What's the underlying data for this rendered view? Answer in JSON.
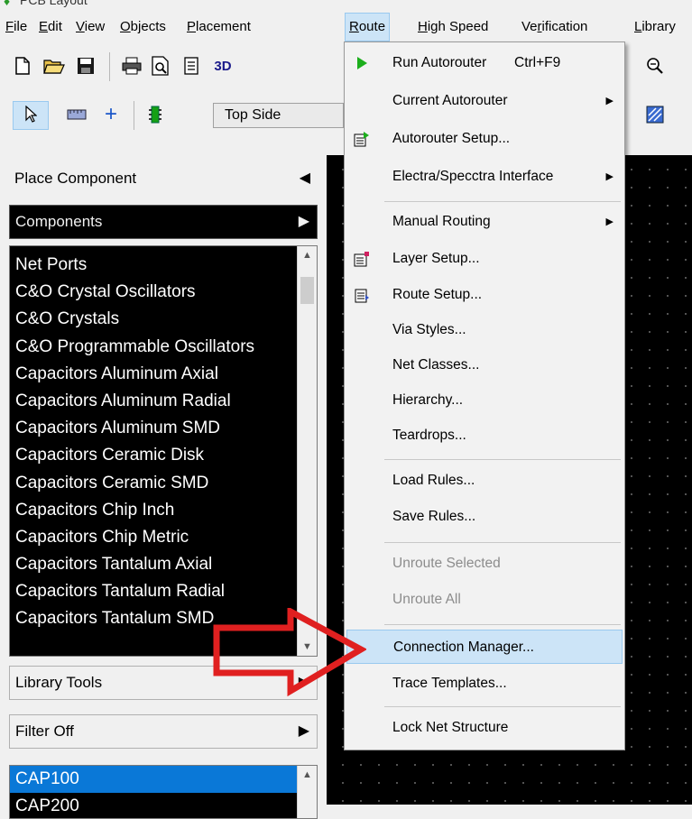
{
  "window": {
    "title": "PCB Layout"
  },
  "menubar": {
    "items": [
      {
        "label": "File",
        "underline": "F"
      },
      {
        "label": "Edit",
        "underline": "E"
      },
      {
        "label": "View",
        "underline": "V"
      },
      {
        "label": "Objects",
        "underline": "O"
      },
      {
        "label": "Placement",
        "underline": "P"
      },
      {
        "label": "Route",
        "underline": "R"
      },
      {
        "label": "High Speed",
        "underline": "H"
      },
      {
        "label": "Verification",
        "underline": "r"
      },
      {
        "label": "Library",
        "underline": "L"
      }
    ]
  },
  "toolbar1": {
    "threed_label": "3D"
  },
  "toolbar2": {
    "layer_select": "Top Side"
  },
  "left_panel": {
    "place_component": "Place Component",
    "components": "Components",
    "component_list": [
      "Net Ports",
      "C&O Crystal Oscillators",
      "C&O Crystals",
      "C&O Programmable Oscillators",
      "Capacitors Aluminum Axial",
      "Capacitors Aluminum Radial",
      "Capacitors Aluminum SMD",
      "Capacitors Ceramic Disk",
      "Capacitors Ceramic SMD",
      "Capacitors Chip Inch",
      "Capacitors Chip Metric",
      "Capacitors Tantalum Axial",
      "Capacitors Tantalum Radial",
      "Capacitors Tantalum SMD"
    ],
    "library_tools": "Library Tools",
    "filter": "Filter Off",
    "parts_list": [
      "CAP100",
      "CAP200"
    ],
    "selected_part": "CAP100"
  },
  "route_menu": {
    "items": [
      {
        "label": "Run Autorouter",
        "shortcut": "Ctrl+F9",
        "icon": "play-icon",
        "submenu": false,
        "disabled": false
      },
      {
        "label": "Current Autorouter",
        "shortcut": "",
        "icon": "",
        "submenu": true,
        "disabled": false
      },
      {
        "label": "Autorouter Setup...",
        "shortcut": "",
        "icon": "autorouter-setup-icon",
        "submenu": false,
        "disabled": false
      },
      {
        "label": "Electra/Specctra Interface",
        "shortcut": "",
        "icon": "",
        "submenu": true,
        "disabled": false
      },
      {
        "label": "Manual Routing",
        "shortcut": "",
        "icon": "",
        "submenu": true,
        "disabled": false
      },
      {
        "label": "Layer Setup...",
        "shortcut": "",
        "icon": "layer-setup-icon",
        "submenu": false,
        "disabled": false
      },
      {
        "label": "Route Setup...",
        "shortcut": "",
        "icon": "route-setup-icon",
        "submenu": false,
        "disabled": false
      },
      {
        "label": "Via Styles...",
        "shortcut": "",
        "icon": "",
        "submenu": false,
        "disabled": false
      },
      {
        "label": "Net Classes...",
        "shortcut": "",
        "icon": "",
        "submenu": false,
        "disabled": false
      },
      {
        "label": "Hierarchy...",
        "shortcut": "",
        "icon": "",
        "submenu": false,
        "disabled": false
      },
      {
        "label": "Teardrops...",
        "shortcut": "",
        "icon": "",
        "submenu": false,
        "disabled": false
      },
      {
        "label": "Load Rules...",
        "shortcut": "",
        "icon": "",
        "submenu": false,
        "disabled": false
      },
      {
        "label": "Save Rules...",
        "shortcut": "",
        "icon": "",
        "submenu": false,
        "disabled": false
      },
      {
        "label": "Unroute Selected",
        "shortcut": "",
        "icon": "",
        "submenu": false,
        "disabled": true
      },
      {
        "label": "Unroute All",
        "shortcut": "",
        "icon": "",
        "submenu": false,
        "disabled": true
      },
      {
        "label": "Connection Manager...",
        "shortcut": "",
        "icon": "",
        "submenu": false,
        "disabled": false,
        "highlighted": true
      },
      {
        "label": "Trace Templates...",
        "shortcut": "",
        "icon": "",
        "submenu": false,
        "disabled": false
      },
      {
        "label": "Lock Net Structure",
        "shortcut": "",
        "icon": "",
        "submenu": false,
        "disabled": false
      }
    ]
  },
  "colors": {
    "menu_highlight": "#cce4f7",
    "selection_blue": "#0a78d7",
    "annotation_arrow": "#e02020",
    "canvas_bg": "#000000"
  }
}
